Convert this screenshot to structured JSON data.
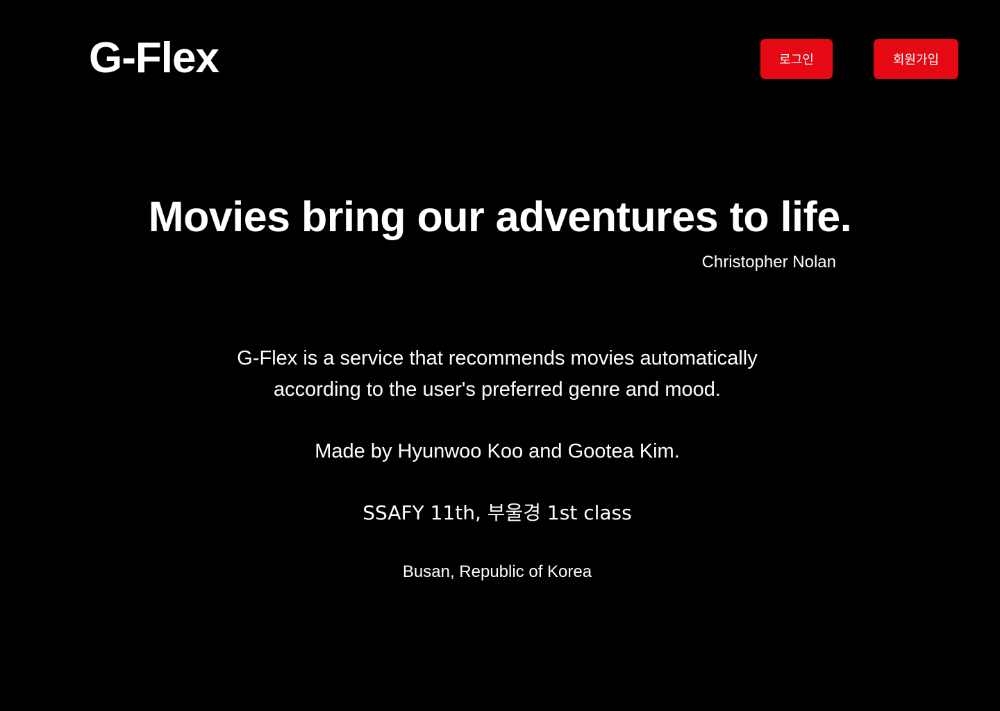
{
  "header": {
    "logo_text": "G-Flex",
    "login_label": "로그인",
    "signup_label": "회원가입"
  },
  "colors": {
    "background": "#000000",
    "text": "#ffffff",
    "accent": "#e50914"
  },
  "hero": {
    "quote": "Movies bring our adventures to life.",
    "author": "Christopher Nolan"
  },
  "about": {
    "description_line1": "G-Flex is a service that recommends movies automatically",
    "description_line2": "according to the user's preferred genre and mood.",
    "credits": "Made by Hyunwoo Koo and Gootea Kim.",
    "class_info": "SSAFY 11th, 부울경 1st class",
    "location": "Busan, Republic of Korea"
  }
}
